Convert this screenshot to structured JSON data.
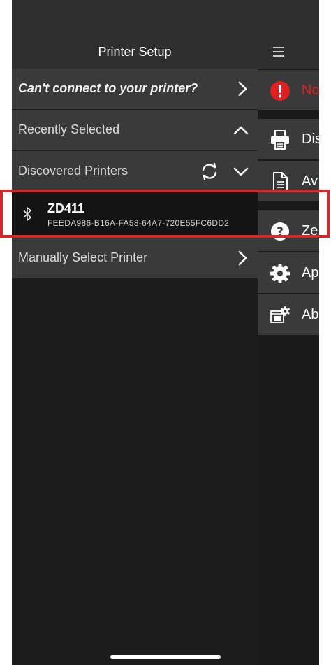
{
  "left_panel": {
    "title": "Printer Setup",
    "cant_connect": "Can't connect to your printer?",
    "recently_selected": "Recently Selected",
    "discovered_printers": "Discovered Printers",
    "manually_select": "Manually Select Printer"
  },
  "printer": {
    "name": "ZD411",
    "id": "FEEDA986-B16A-FA58-64A7-720E55FC6DD2",
    "connection_icon": "bluetooth-icon"
  },
  "right_menu": {
    "items": [
      {
        "label": "No",
        "icon": "alert-icon"
      },
      {
        "label": "Dis",
        "icon": "printer-icon"
      },
      {
        "label": "Av",
        "icon": "document-icon"
      },
      {
        "label": "Ze",
        "icon": "help-icon"
      },
      {
        "label": "Ap",
        "icon": "gear-icon"
      },
      {
        "label": "Ab",
        "icon": "about-icon"
      }
    ]
  },
  "colors": {
    "highlight": "#d0282b",
    "alert": "#e02020",
    "background": "#1c1c1c",
    "row": "#3a3a3a"
  }
}
